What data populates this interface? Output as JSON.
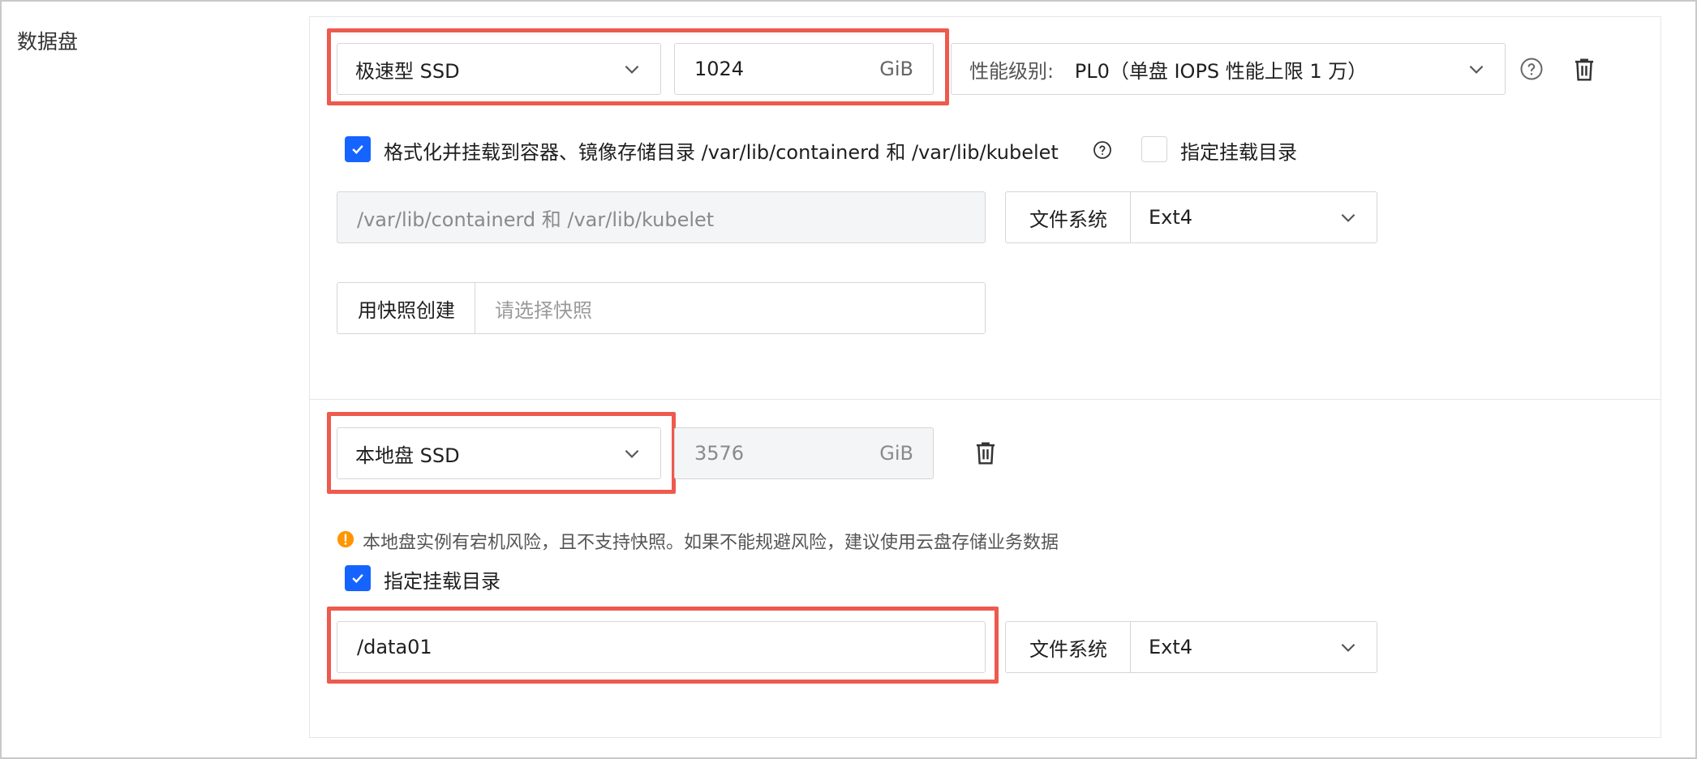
{
  "section": {
    "label": "数据盘"
  },
  "disk1": {
    "type_value": "极速型 SSD",
    "size_value": "1024",
    "size_unit": "GiB",
    "perf_label": "性能级别:",
    "perf_value": "PL0（单盘 IOPS 性能上限 1 万）",
    "format_checkbox_label": "格式化并挂载到容器、镜像存储目录 /var/lib/containerd 和 /var/lib/kubelet",
    "custom_mount_label": "指定挂载目录",
    "mount_path_value": "/var/lib/containerd 和 /var/lib/kubelet",
    "fs_label": "文件系统",
    "fs_value": "Ext4",
    "snapshot_label": "用快照创建",
    "snapshot_placeholder": "请选择快照"
  },
  "disk2": {
    "type_value": "本地盘 SSD",
    "size_value": "3576",
    "size_unit": "GiB",
    "warning_text": "本地盘实例有宕机风险，且不支持快照。如果不能规避风险，建议使用云盘存储业务数据",
    "custom_mount_label": "指定挂载目录",
    "mount_path_value": "/data01",
    "fs_label": "文件系统",
    "fs_value": "Ext4"
  },
  "colors": {
    "accent": "#1664ff",
    "highlight": "#ee5a4e",
    "warning": "#ff9500"
  },
  "icons": {
    "help": "help-circle-icon",
    "delete": "trash-icon",
    "dropdown": "chevron-down-icon",
    "check": "check-icon",
    "warning": "warning-circle-icon"
  }
}
